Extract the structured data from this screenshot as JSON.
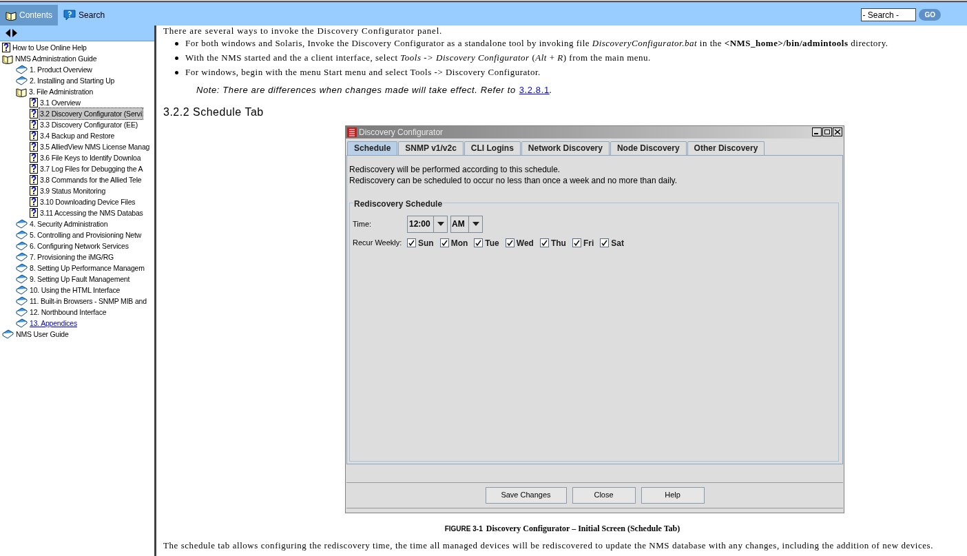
{
  "header": {
    "tabs": [
      {
        "label": "Contents",
        "selected": true
      },
      {
        "label": "Search",
        "selected": false
      }
    ],
    "search": {
      "value": "- Search -"
    },
    "go_button": "GO"
  },
  "toc": {
    "items": [
      {
        "label": "How to Use Online Help",
        "kind": "page",
        "selected": false,
        "link": false
      },
      {
        "label": "NMS Administration Guide",
        "kind": "open-book",
        "selected": false,
        "link": false,
        "children": [
          {
            "label": "1. Product Overview",
            "kind": "book",
            "selected": false,
            "link": false
          },
          {
            "label": "2. Installing and Starting Up",
            "kind": "book",
            "selected": false,
            "link": false
          },
          {
            "label": "3.  File Administration",
            "kind": "open-book",
            "selected": false,
            "link": false,
            "children": [
              {
                "label": "3.1 Overview",
                "kind": "page",
                "selected": false,
                "link": false
              },
              {
                "label": "3.2 Discovery Configurator (Servi",
                "kind": "page",
                "selected": true,
                "link": false
              },
              {
                "label": "3.3 Discovery Configurator (EE)",
                "kind": "page",
                "selected": false,
                "link": false
              },
              {
                "label": "3.4 Backup and Restore",
                "kind": "page",
                "selected": false,
                "link": false
              },
              {
                "label": "3.5 AlliedView NMS License Manag",
                "kind": "page",
                "selected": false,
                "link": false
              },
              {
                "label": "3.6 File Keys to Identify Downloa",
                "kind": "page",
                "selected": false,
                "link": false
              },
              {
                "label": "3.7 Log Files for Debugging the A",
                "kind": "page",
                "selected": false,
                "link": false
              },
              {
                "label": "3.8 Commands for the Allied Tele",
                "kind": "page",
                "selected": false,
                "link": false
              },
              {
                "label": "3.9 Status Monitoring",
                "kind": "page",
                "selected": false,
                "link": false
              },
              {
                "label": "3.10 Downloading Device Files",
                "kind": "page",
                "selected": false,
                "link": false
              },
              {
                "label": "3.11 Accessing the NMS Databas",
                "kind": "page",
                "selected": false,
                "link": false
              }
            ]
          },
          {
            "label": "4.  Security Administration",
            "kind": "book",
            "selected": false,
            "link": false
          },
          {
            "label": "5.  Controlling and Provisioning Netw",
            "kind": "book",
            "selected": false,
            "link": false
          },
          {
            "label": "6.  Configuring Network Services",
            "kind": "book",
            "selected": false,
            "link": false
          },
          {
            "label": "7.  Provisioning the iMG/RG",
            "kind": "book",
            "selected": false,
            "link": false
          },
          {
            "label": "8. Setting Up Performance Managem",
            "kind": "book",
            "selected": false,
            "link": false
          },
          {
            "label": "9.  Setting Up Fault Management",
            "kind": "book",
            "selected": false,
            "link": false
          },
          {
            "label": "10. Using the HTML Interface",
            "kind": "book",
            "selected": false,
            "link": false
          },
          {
            "label": "11.  Built-in Browsers - SNMP MIB and",
            "kind": "book",
            "selected": false,
            "link": false
          },
          {
            "label": "12.  Northbound Interface",
            "kind": "book",
            "selected": false,
            "link": false
          },
          {
            "label": "13. Appendices",
            "kind": "book",
            "selected": false,
            "link": true
          }
        ]
      },
      {
        "label": "NMS User Guide",
        "kind": "book",
        "selected": false,
        "link": false
      }
    ]
  },
  "content": {
    "intro": "There are several ways to invoke the Discovery Configurator panel.",
    "bullets": [
      "For both windows and Solaris, Invoke the Discovery Configurator as a standalone tool by invoking file *DiscoveryConfigurator.bat* in the **<NMS_home>/bin/admintools** directory.",
      "With the NMS started and the a client interface, select *Tools -> Discovery Configurator* (*Alt* + *R*) from the main menu.",
      "For windows, begin with the menu Start menu and select Tools -> Discovery Configurator."
    ],
    "note": {
      "text": "Note:  There are differences when changes made will take effect. Refer to",
      "link": "3.2.8.1",
      "after": "."
    },
    "heading": "3.2.2  Schedule Tab",
    "dialog": {
      "title": "Discovery Configurator",
      "tabs": [
        {
          "label": "Schedule",
          "selected": true
        },
        {
          "label": "SNMP v1/v2c",
          "selected": false
        },
        {
          "label": "CLI Logins",
          "selected": false
        },
        {
          "label": "Network Discovery",
          "selected": false
        },
        {
          "label": "Node Discovery",
          "selected": false
        },
        {
          "label": "Other Discovery",
          "selected": false
        }
      ],
      "description": [
        "Rediscovery will be performed according to this schedule.",
        "Rediscovery can be scheduled to occur no less than once a week and no more than daily."
      ],
      "group_title": "Rediscovery Schedule",
      "time_label": "Time:",
      "time_value": "12:00",
      "ampm_value": "AM",
      "recur_label": "Recur Weekly:",
      "days": [
        {
          "label": "Sun",
          "checked": true
        },
        {
          "label": "Mon",
          "checked": true
        },
        {
          "label": "Tue",
          "checked": true
        },
        {
          "label": "Wed",
          "checked": true
        },
        {
          "label": "Thu",
          "checked": true
        },
        {
          "label": "Fri",
          "checked": true
        },
        {
          "label": "Sat",
          "checked": true
        }
      ],
      "buttons": [
        "Save Changes",
        "Close",
        "Help"
      ]
    },
    "caption": {
      "label": "FIGURE 3-1",
      "text": "Discovery Configurator – Initial Screen (Schedule Tab)"
    },
    "paragraph": "The schedule tab allows configuring the rediscovery time, the time all managed devices will be rediscovered to update the NMS database with any changes, including the addition of new devices."
  }
}
